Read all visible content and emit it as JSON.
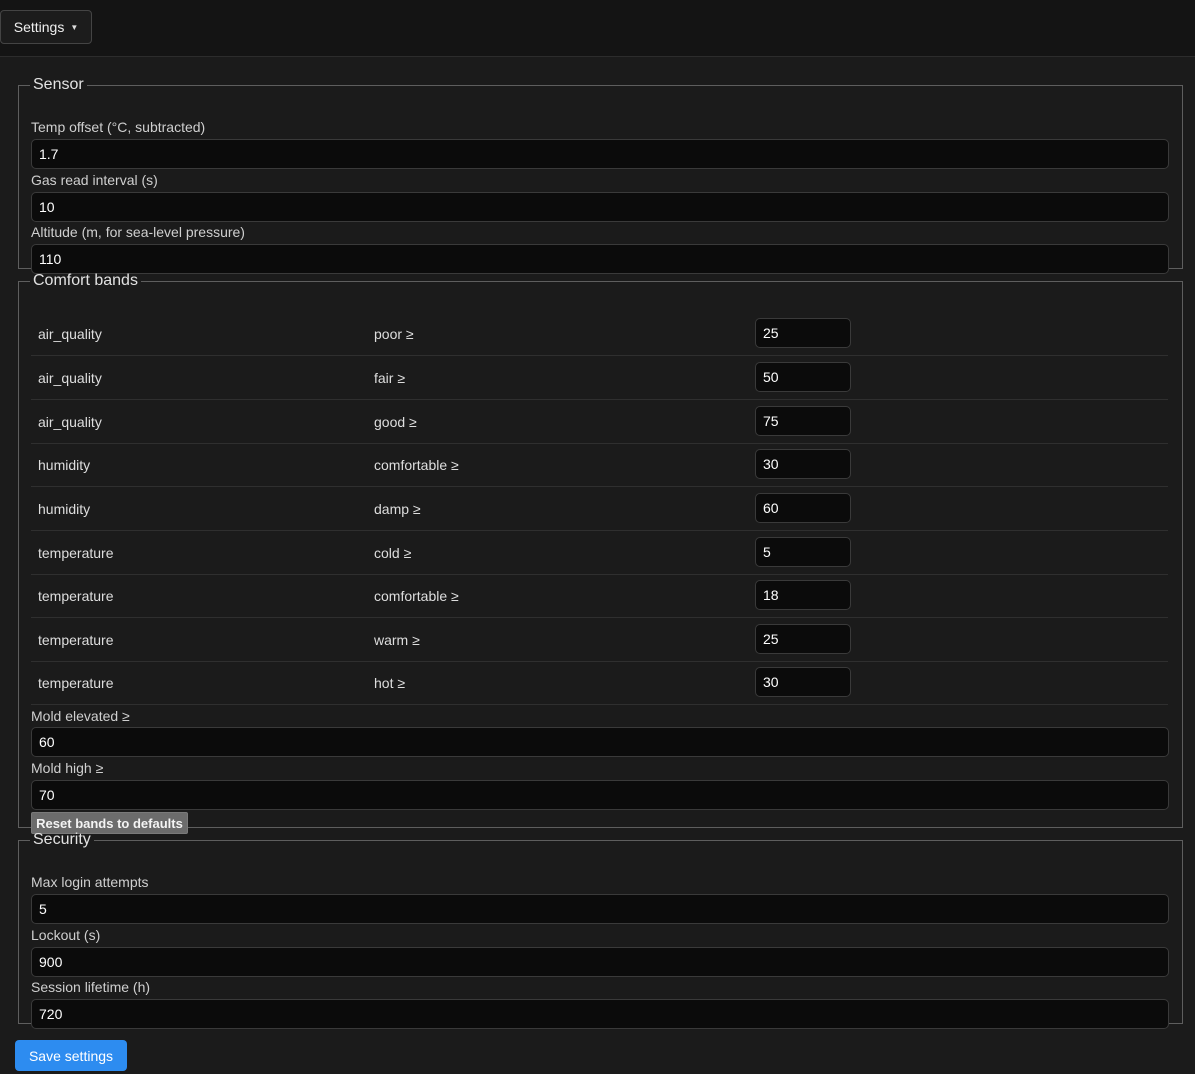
{
  "menu": {
    "settings_label": "Settings"
  },
  "sensor": {
    "legend": "Sensor",
    "temp_offset": {
      "label": "Temp offset (°C, subtracted)",
      "value": "1.7"
    },
    "gas_interval": {
      "label": "Gas read interval (s)",
      "value": "10"
    },
    "altitude": {
      "label": "Altitude (m, for sea-level pressure)",
      "value": "110"
    }
  },
  "bands": {
    "legend": "Comfort bands",
    "rows": [
      {
        "metric": "air_quality",
        "level": "poor ≥",
        "value": "25"
      },
      {
        "metric": "air_quality",
        "level": "fair ≥",
        "value": "50"
      },
      {
        "metric": "air_quality",
        "level": "good ≥",
        "value": "75"
      },
      {
        "metric": "humidity",
        "level": "comfortable ≥",
        "value": "30"
      },
      {
        "metric": "humidity",
        "level": "damp ≥",
        "value": "60"
      },
      {
        "metric": "temperature",
        "level": "cold ≥",
        "value": "5"
      },
      {
        "metric": "temperature",
        "level": "comfortable ≥",
        "value": "18"
      },
      {
        "metric": "temperature",
        "level": "warm ≥",
        "value": "25"
      },
      {
        "metric": "temperature",
        "level": "hot ≥",
        "value": "30"
      }
    ],
    "mold_elevated": {
      "label": "Mold elevated ≥",
      "value": "60"
    },
    "mold_high": {
      "label": "Mold high ≥",
      "value": "70"
    },
    "reset_label": "Reset bands to defaults"
  },
  "security": {
    "legend": "Security",
    "max_login": {
      "label": "Max login attempts",
      "value": "5"
    },
    "lockout": {
      "label": "Lockout (s)",
      "value": "900"
    },
    "session": {
      "label": "Session lifetime (h)",
      "value": "720"
    }
  },
  "save_label": "Save settings",
  "colors": {
    "accent": "#2d8cf0",
    "background": "#1b1b1b",
    "input_bg": "#0b0b0b"
  }
}
